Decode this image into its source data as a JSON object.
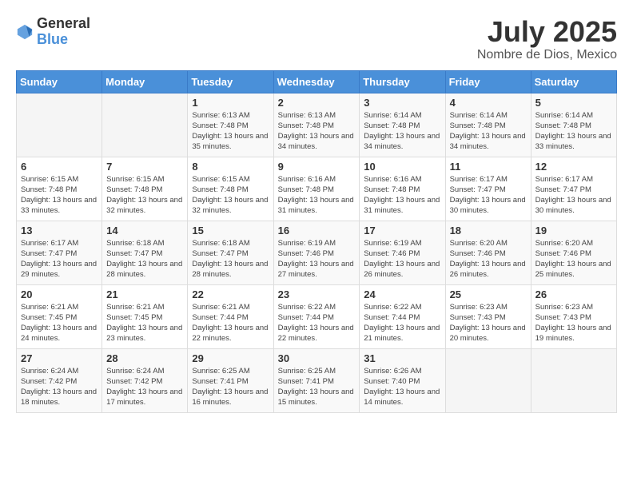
{
  "logo": {
    "general": "General",
    "blue": "Blue"
  },
  "header": {
    "month_year": "July 2025",
    "location": "Nombre de Dios, Mexico"
  },
  "weekdays": [
    "Sunday",
    "Monday",
    "Tuesday",
    "Wednesday",
    "Thursday",
    "Friday",
    "Saturday"
  ],
  "weeks": [
    [
      {
        "day": "",
        "info": ""
      },
      {
        "day": "",
        "info": ""
      },
      {
        "day": "1",
        "info": "Sunrise: 6:13 AM\nSunset: 7:48 PM\nDaylight: 13 hours and 35 minutes."
      },
      {
        "day": "2",
        "info": "Sunrise: 6:13 AM\nSunset: 7:48 PM\nDaylight: 13 hours and 34 minutes."
      },
      {
        "day": "3",
        "info": "Sunrise: 6:14 AM\nSunset: 7:48 PM\nDaylight: 13 hours and 34 minutes."
      },
      {
        "day": "4",
        "info": "Sunrise: 6:14 AM\nSunset: 7:48 PM\nDaylight: 13 hours and 34 minutes."
      },
      {
        "day": "5",
        "info": "Sunrise: 6:14 AM\nSunset: 7:48 PM\nDaylight: 13 hours and 33 minutes."
      }
    ],
    [
      {
        "day": "6",
        "info": "Sunrise: 6:15 AM\nSunset: 7:48 PM\nDaylight: 13 hours and 33 minutes."
      },
      {
        "day": "7",
        "info": "Sunrise: 6:15 AM\nSunset: 7:48 PM\nDaylight: 13 hours and 32 minutes."
      },
      {
        "day": "8",
        "info": "Sunrise: 6:15 AM\nSunset: 7:48 PM\nDaylight: 13 hours and 32 minutes."
      },
      {
        "day": "9",
        "info": "Sunrise: 6:16 AM\nSunset: 7:48 PM\nDaylight: 13 hours and 31 minutes."
      },
      {
        "day": "10",
        "info": "Sunrise: 6:16 AM\nSunset: 7:48 PM\nDaylight: 13 hours and 31 minutes."
      },
      {
        "day": "11",
        "info": "Sunrise: 6:17 AM\nSunset: 7:47 PM\nDaylight: 13 hours and 30 minutes."
      },
      {
        "day": "12",
        "info": "Sunrise: 6:17 AM\nSunset: 7:47 PM\nDaylight: 13 hours and 30 minutes."
      }
    ],
    [
      {
        "day": "13",
        "info": "Sunrise: 6:17 AM\nSunset: 7:47 PM\nDaylight: 13 hours and 29 minutes."
      },
      {
        "day": "14",
        "info": "Sunrise: 6:18 AM\nSunset: 7:47 PM\nDaylight: 13 hours and 28 minutes."
      },
      {
        "day": "15",
        "info": "Sunrise: 6:18 AM\nSunset: 7:47 PM\nDaylight: 13 hours and 28 minutes."
      },
      {
        "day": "16",
        "info": "Sunrise: 6:19 AM\nSunset: 7:46 PM\nDaylight: 13 hours and 27 minutes."
      },
      {
        "day": "17",
        "info": "Sunrise: 6:19 AM\nSunset: 7:46 PM\nDaylight: 13 hours and 26 minutes."
      },
      {
        "day": "18",
        "info": "Sunrise: 6:20 AM\nSunset: 7:46 PM\nDaylight: 13 hours and 26 minutes."
      },
      {
        "day": "19",
        "info": "Sunrise: 6:20 AM\nSunset: 7:46 PM\nDaylight: 13 hours and 25 minutes."
      }
    ],
    [
      {
        "day": "20",
        "info": "Sunrise: 6:21 AM\nSunset: 7:45 PM\nDaylight: 13 hours and 24 minutes."
      },
      {
        "day": "21",
        "info": "Sunrise: 6:21 AM\nSunset: 7:45 PM\nDaylight: 13 hours and 23 minutes."
      },
      {
        "day": "22",
        "info": "Sunrise: 6:21 AM\nSunset: 7:44 PM\nDaylight: 13 hours and 22 minutes."
      },
      {
        "day": "23",
        "info": "Sunrise: 6:22 AM\nSunset: 7:44 PM\nDaylight: 13 hours and 22 minutes."
      },
      {
        "day": "24",
        "info": "Sunrise: 6:22 AM\nSunset: 7:44 PM\nDaylight: 13 hours and 21 minutes."
      },
      {
        "day": "25",
        "info": "Sunrise: 6:23 AM\nSunset: 7:43 PM\nDaylight: 13 hours and 20 minutes."
      },
      {
        "day": "26",
        "info": "Sunrise: 6:23 AM\nSunset: 7:43 PM\nDaylight: 13 hours and 19 minutes."
      }
    ],
    [
      {
        "day": "27",
        "info": "Sunrise: 6:24 AM\nSunset: 7:42 PM\nDaylight: 13 hours and 18 minutes."
      },
      {
        "day": "28",
        "info": "Sunrise: 6:24 AM\nSunset: 7:42 PM\nDaylight: 13 hours and 17 minutes."
      },
      {
        "day": "29",
        "info": "Sunrise: 6:25 AM\nSunset: 7:41 PM\nDaylight: 13 hours and 16 minutes."
      },
      {
        "day": "30",
        "info": "Sunrise: 6:25 AM\nSunset: 7:41 PM\nDaylight: 13 hours and 15 minutes."
      },
      {
        "day": "31",
        "info": "Sunrise: 6:26 AM\nSunset: 7:40 PM\nDaylight: 13 hours and 14 minutes."
      },
      {
        "day": "",
        "info": ""
      },
      {
        "day": "",
        "info": ""
      }
    ]
  ]
}
